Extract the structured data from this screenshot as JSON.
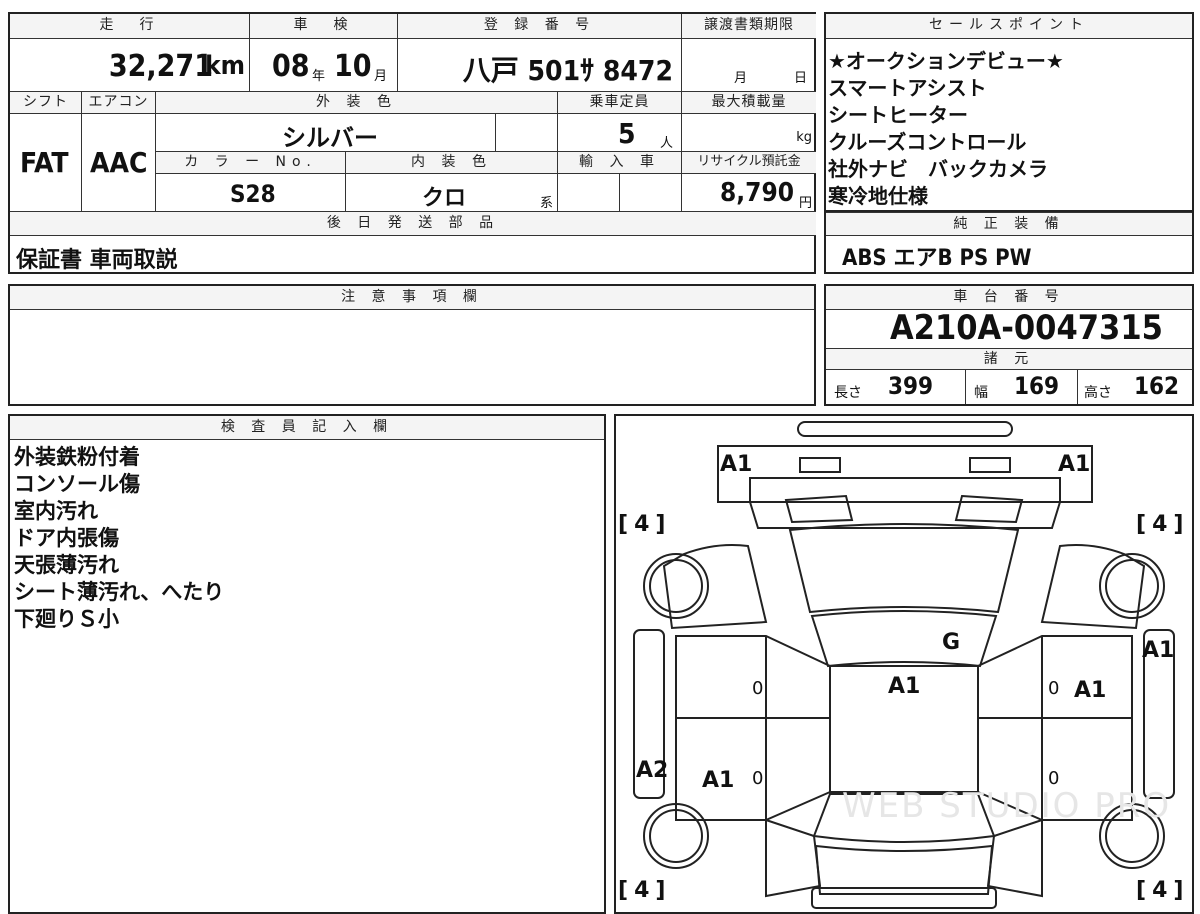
{
  "summary": {
    "mileage_label": "走　行",
    "mileage": "32,271",
    "mileage_unit": "km",
    "inspection_label": "車　検",
    "inspection_year": "08",
    "year_unit": "年",
    "inspection_month": "10",
    "month_unit": "月",
    "registration_label": "登 録 番 号",
    "registration": "八戸 501ｻ 8472",
    "transfer_label": "譲渡書類期限",
    "transfer_month_unit": "月",
    "transfer_day_unit": "日",
    "shift_label": "シフト",
    "shift": "FAT",
    "ac_label": "エアコン",
    "ac": "AAC",
    "exterior_label": "外 装 色",
    "exterior": "シルバー",
    "capacity_label": "乗車定員",
    "capacity": "5",
    "capacity_unit": "人",
    "max_load_label": "最大積載量",
    "max_load_unit": "kg",
    "color_no_label": "カ ラ ー No.",
    "color_no": "S28",
    "interior_label": "内 装 色",
    "interior": "クロ",
    "interior_unit": "系",
    "import_label": "輸 入 車",
    "recycle_label": "リサイクル預託金",
    "recycle": "8,790",
    "recycle_unit": "円",
    "later_label": "後 日 発 送 部 品",
    "later": "保証書 車両取説"
  },
  "sales_points": {
    "label": "セールスポイント",
    "items": [
      "★オークションデビュー★",
      "スマートアシスト",
      "シートヒーター",
      "クルーズコントロール",
      "社外ナビ　バックカメラ",
      "寒冷地仕様"
    ]
  },
  "equipment": {
    "label": "純 正 装 備",
    "value": "ABS エアB PS PW"
  },
  "notes": {
    "label": "注 意 事 項 欄"
  },
  "chassis": {
    "label": "車 台 番 号",
    "value": "A210A-0047315"
  },
  "specs": {
    "label": "諸 元",
    "length_label": "長さ",
    "length": "399",
    "width_label": "幅",
    "width": "169",
    "height_label": "高さ",
    "height": "162"
  },
  "inspector": {
    "label": "検 査 員 記 入 欄",
    "items": [
      "外装鉄粉付着",
      "コンソール傷",
      "室内汚れ",
      "ドア内張傷",
      "天張薄汚れ",
      "シート薄汚れ、へたり",
      "下廻りＳ小"
    ]
  },
  "diagram": {
    "marks": {
      "front_left": "A1",
      "front_right": "A1",
      "tire_fl": "4",
      "tire_fr": "4",
      "tire_rl": "4",
      "tire_rr": "4",
      "windshield": "G",
      "roof": "A1",
      "right_side": "A1",
      "right_door": "A1",
      "left_rear_panel": "A2",
      "left_rear_door": "A1",
      "zero_1": "0",
      "zero_2": "0",
      "zero_3": "0",
      "zero_4": "0"
    },
    "watermark": "WEB STUDIO PRO"
  }
}
